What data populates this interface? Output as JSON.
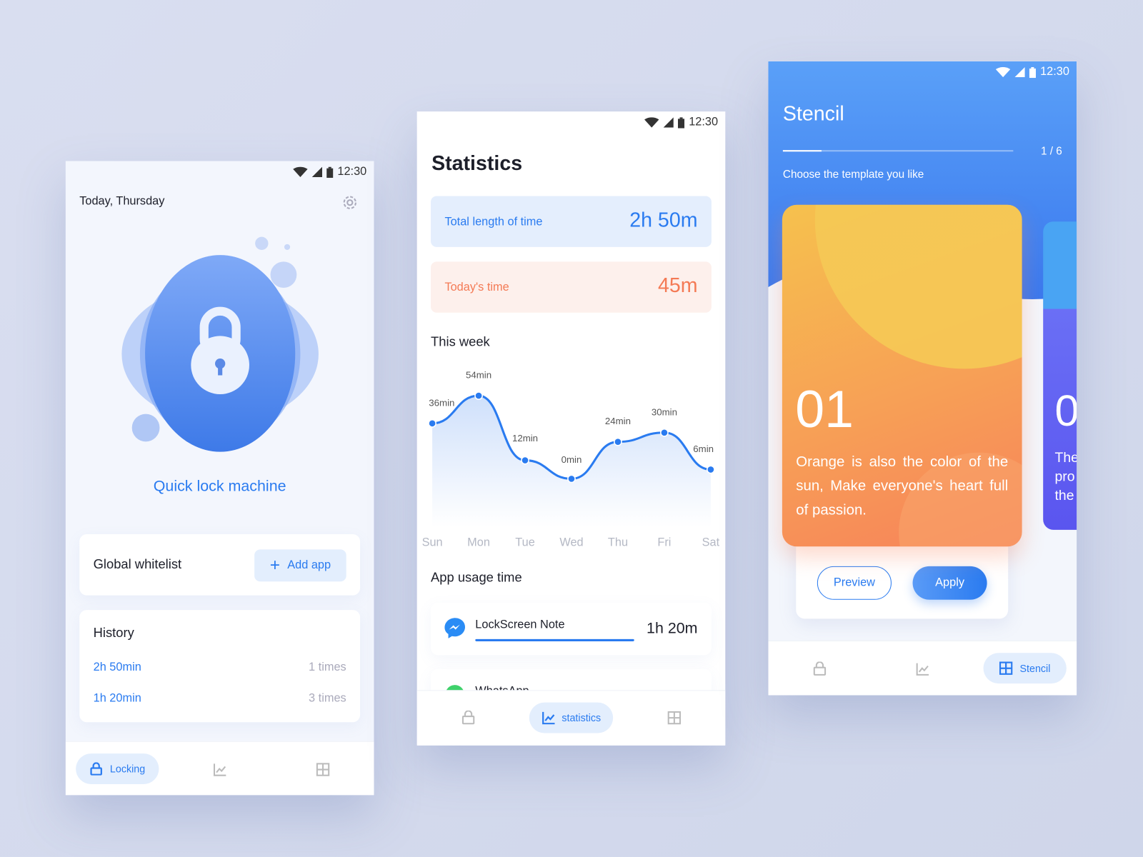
{
  "status_bar": {
    "time": "12:30"
  },
  "locking": {
    "date": "Today, Thursday",
    "title": "Quick lock machine",
    "whitelist": {
      "label": "Global whitelist",
      "button": "Add app"
    },
    "history": {
      "title": "History",
      "rows": [
        {
          "duration": "2h 50min",
          "count": "1 times"
        },
        {
          "duration": "1h 20min",
          "count": "3 times"
        }
      ]
    },
    "nav": {
      "active_label": "Locking"
    }
  },
  "statistics": {
    "title": "Statistics",
    "total": {
      "label": "Total length of time",
      "value": "2h 50m"
    },
    "today": {
      "label": "Today's time",
      "value": "45m"
    },
    "week_title": "This week",
    "usage_title": "App usage time",
    "apps": [
      {
        "name": "LockScreen Note",
        "time": "1h 20m",
        "usage_fraction": 0.57
      },
      {
        "name": "WhatsApp",
        "time": ""
      }
    ],
    "nav": {
      "active_label": "statistics"
    }
  },
  "chart_data": {
    "type": "line",
    "categories": [
      "Sun",
      "Mon",
      "Tue",
      "Wed",
      "Thu",
      "Fri",
      "Sat"
    ],
    "values": [
      36,
      54,
      12,
      0,
      24,
      30,
      6
    ],
    "data_labels": [
      "36min",
      "54min",
      "12min",
      "0min",
      "24min",
      "30min",
      "6min"
    ],
    "unit": "min",
    "grid": false,
    "color": "#2a7bf0"
  },
  "stencil": {
    "title": "Stencil",
    "page": "1 / 6",
    "progress": 0.1667,
    "subtitle": "Choose the template you like",
    "card": {
      "number": "01",
      "text": "Orange is also the color of the sun, Make everyone's heart full of passion."
    },
    "next_card": {
      "number": "0",
      "text": "The pro the"
    },
    "preview": "Preview",
    "apply": "Apply",
    "nav": {
      "active_label": "Stencil"
    }
  },
  "colors": {
    "accent": "#2a7bf0",
    "orange": "#f47a55",
    "background": "#d5dbec"
  }
}
